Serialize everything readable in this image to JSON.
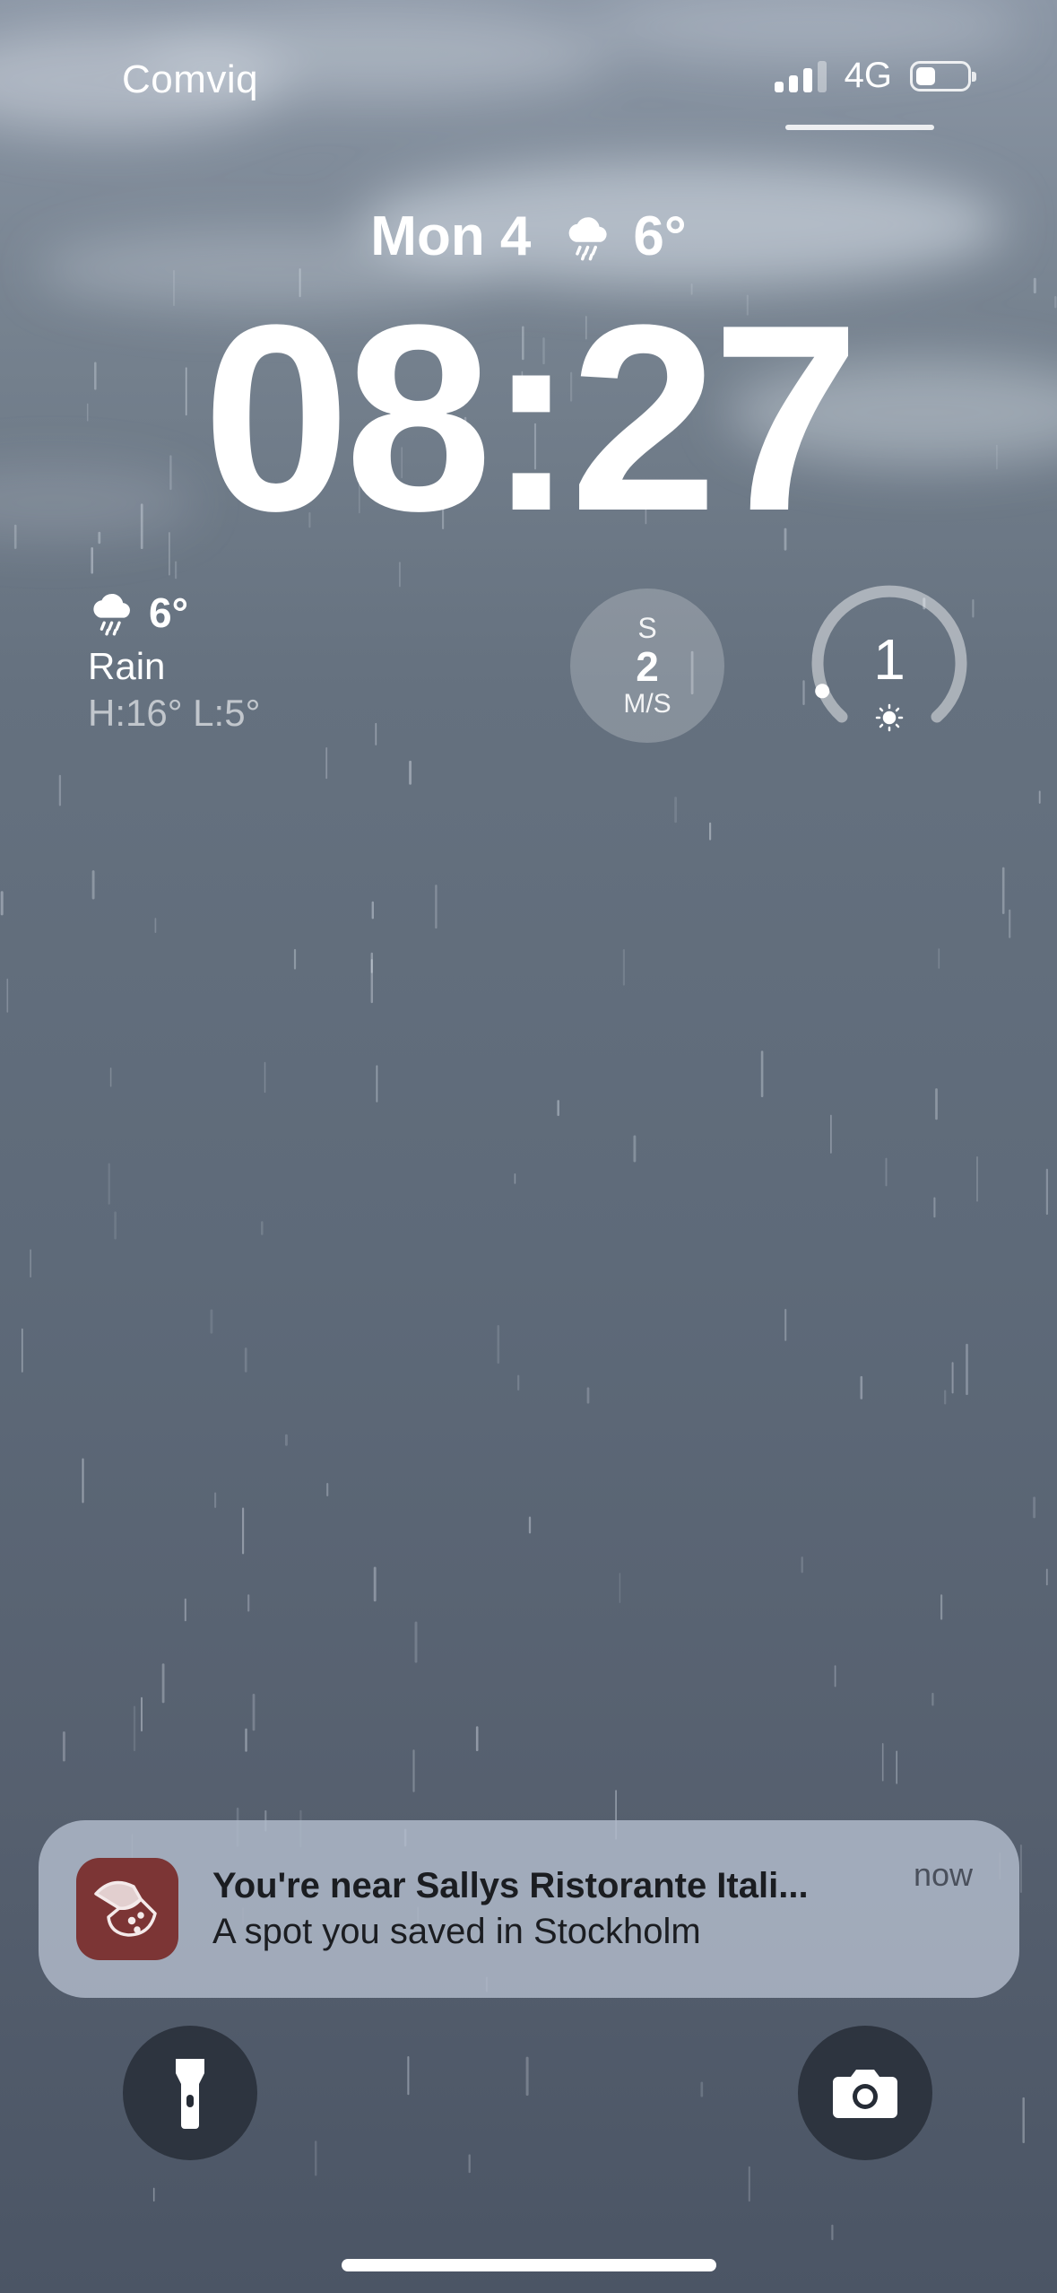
{
  "status_bar": {
    "carrier": "Comviq",
    "network": "4G",
    "signal_bars_active": 3,
    "signal_bars_total": 4,
    "battery_level": 0.2
  },
  "lock_screen": {
    "date": "Mon 4",
    "date_weather_icon": "cloud-rain-icon",
    "date_temperature": "6°",
    "time": "08:27"
  },
  "widgets": {
    "weather": {
      "icon": "cloud-rain-icon",
      "temperature": "6°",
      "condition": "Rain",
      "high_low": "H:16° L:5°"
    },
    "wind": {
      "direction": "S",
      "speed": "2",
      "unit": "M/S"
    },
    "uv_index": {
      "value": "1",
      "icon": "sun-icon",
      "level": 0.09
    }
  },
  "notification": {
    "app_icon": "restaurant-app-icon",
    "title": "You're near Sallys Ristorante Itali...",
    "body": "A spot you saved in Stockholm",
    "time": "now"
  },
  "quick_actions": {
    "left": "flashlight-icon",
    "right": "camera-icon"
  },
  "colors": {
    "background_top": "#8c97a6",
    "background_bottom": "#4b5565",
    "notification_bg": "#b2bccc",
    "app_icon_bg": "#7c3535",
    "action_button_bg": "#262c36"
  }
}
